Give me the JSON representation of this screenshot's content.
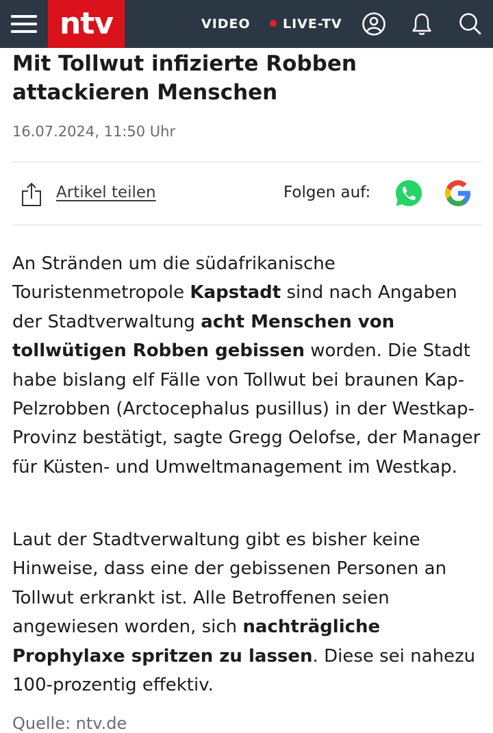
{
  "header": {
    "logo": "ntv",
    "nav_video": "VIDEO",
    "nav_live": "LIVE-TV",
    "icons": [
      "menu-icon",
      "user-icon",
      "bell-icon",
      "search-icon"
    ],
    "bar_color": "#2c3744",
    "brand_color": "#d9121b",
    "live_dot_color": "#e4202d"
  },
  "article": {
    "headline": "Mit Tollwut infizierte Robben attackieren Menschen",
    "date": "16.07.2024, 11:50 Uhr",
    "share_label": "Artikel teilen",
    "follow_label": "Folgen auf:",
    "follow_icons": [
      "whatsapp-icon",
      "google-icon"
    ],
    "paragraphs": [
      [
        {
          "text": "An Stränden um die südafrikanische Touristenmetropole ",
          "bold": false
        },
        {
          "text": "Kapstadt",
          "bold": true
        },
        {
          "text": " sind nach Angaben der Stadtverwaltung ",
          "bold": false
        },
        {
          "text": "acht Menschen von tollwütigen Robben gebissen",
          "bold": true
        },
        {
          "text": " worden. Die Stadt habe bislang elf Fälle von Tollwut bei braunen Kap-Pelzrobben (Arctocephalus pusillus) in der Westkap-Provinz bestätigt, sagte Gregg Oelofse, der Manager für Küsten- und Umweltmanagement im Westkap.",
          "bold": false
        }
      ],
      [
        {
          "text": "Laut der Stadtverwaltung gibt es bisher keine Hinweise, dass eine der gebissenen Personen an Tollwut erkrankt ist. Alle Betroffenen seien angewiesen worden, sich ",
          "bold": false
        },
        {
          "text": "nachträgliche Prophylaxe spritzen zu lassen",
          "bold": true
        },
        {
          "text": ". Diese sei nahezu 100-prozentig effektiv.",
          "bold": false
        }
      ]
    ],
    "source": "Quelle: ntv.de"
  }
}
